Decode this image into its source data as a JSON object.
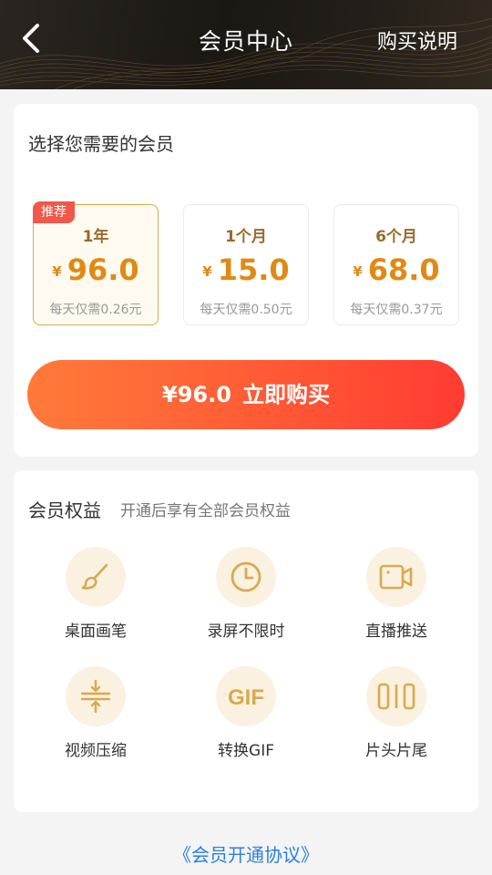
{
  "header": {
    "title": "会员中心",
    "link_label": "购买说明"
  },
  "plans_section": {
    "title": "选择您需要的会员",
    "plans": [
      {
        "badge": "推荐",
        "name": "1年",
        "currency": "¥",
        "price": "96.0",
        "daily": "每天仅需0.26元",
        "selected": true
      },
      {
        "badge": "",
        "name": "1个月",
        "currency": "¥",
        "price": "15.0",
        "daily": "每天仅需0.50元",
        "selected": false
      },
      {
        "badge": "",
        "name": "6个月",
        "currency": "¥",
        "price": "68.0",
        "daily": "每天仅需0.37元",
        "selected": false
      }
    ],
    "buy_price": "¥96.0",
    "buy_label": "立即购买"
  },
  "benefits_section": {
    "title": "会员权益",
    "subtitle": "开通后享有全部会员权益",
    "items": [
      {
        "icon": "brush-icon",
        "label": "桌面画笔"
      },
      {
        "icon": "clock-icon",
        "label": "录屏不限时"
      },
      {
        "icon": "video-camera-icon",
        "label": "直播推送"
      },
      {
        "icon": "compress-icon",
        "label": "视频压缩"
      },
      {
        "icon": "gif-icon",
        "label": "转换GIF"
      },
      {
        "icon": "head-tail-icon",
        "label": "片头片尾"
      }
    ]
  },
  "footer": {
    "agreement": "《会员开通协议》"
  },
  "colors": {
    "accent_gold": "#d9a94f",
    "price_orange": "#e08a14",
    "button_start": "#ff7a3a",
    "button_end": "#ff3b32",
    "link_blue": "#2a7fe0",
    "badge_red": "#f2574a"
  }
}
